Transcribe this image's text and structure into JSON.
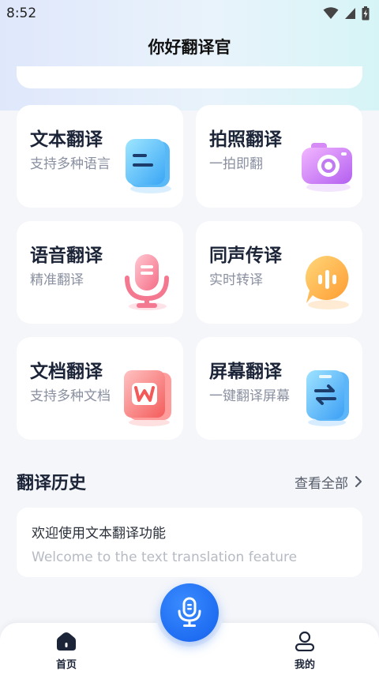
{
  "status_bar": {
    "time": "8:52"
  },
  "header": {
    "title": "你好翻译官"
  },
  "features": [
    {
      "title": "文本翻译",
      "subtitle": "支持多种语言",
      "icon": "text-document-icon"
    },
    {
      "title": "拍照翻译",
      "subtitle": "一拍即翻",
      "icon": "camera-icon"
    },
    {
      "title": "语音翻译",
      "subtitle": "精准翻译",
      "icon": "microphone-icon"
    },
    {
      "title": "同声传译",
      "subtitle": "实时转译",
      "icon": "sound-wave-bubble-icon"
    },
    {
      "title": "文档翻译",
      "subtitle": "支持多种文档",
      "icon": "word-document-icon"
    },
    {
      "title": "屏幕翻译",
      "subtitle": "一键翻译屏幕",
      "icon": "phone-swap-icon"
    }
  ],
  "history": {
    "title": "翻译历史",
    "view_all": "查看全部",
    "items": [
      {
        "source": "欢迎使用文本翻译功能",
        "target": "Welcome to the text translation feature"
      }
    ]
  },
  "bottom_nav": {
    "home": "首页",
    "mine": "我的",
    "fab_icon": "microphone-icon"
  },
  "colors": {
    "accent": "#1f6df2",
    "title": "#1c2438",
    "subtitle": "#8a90a0"
  }
}
